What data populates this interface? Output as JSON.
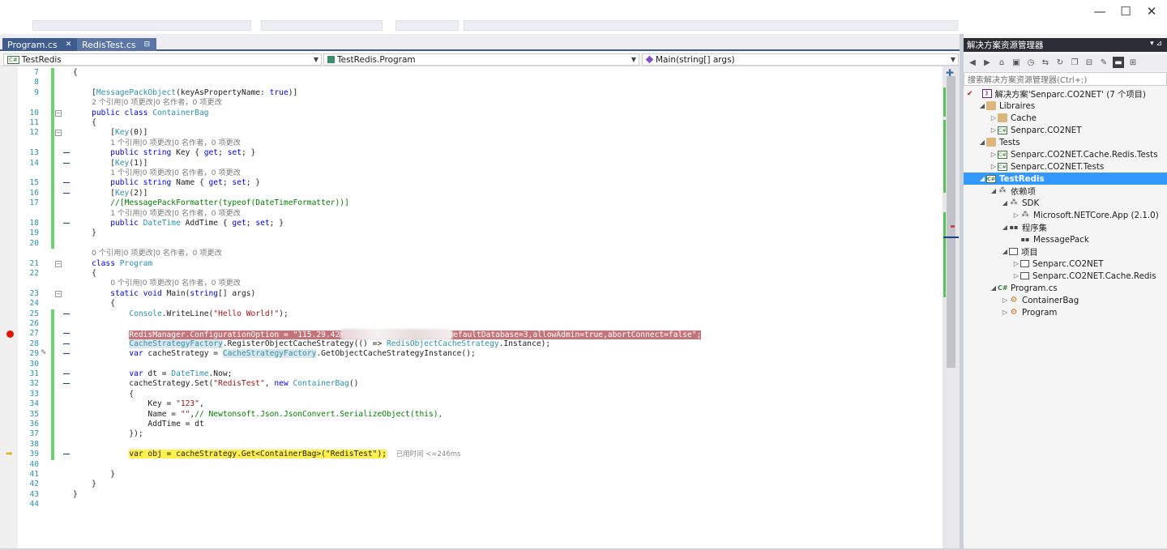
{
  "window": {
    "minimize": "—",
    "maximize": "☐",
    "close": "✕"
  },
  "tabs": [
    {
      "label": "Program.cs",
      "pin": "✕",
      "active": true
    },
    {
      "label": "RedisTest.cs",
      "pin": "⊟",
      "active": false
    }
  ],
  "nav": {
    "project": "TestRedis",
    "type": "TestRedis.Program",
    "member": "Main(string[] args)"
  },
  "editor": {
    "elapsed": "已用时间 <=246ms",
    "blurred_connection_suffix": "efaultDatabase=3,allowAdmin=true,abortConnect=false\";",
    "connection_prefix": "RedisManager.ConfigurationOption = \"115.29.42"
  },
  "solution_explorer": {
    "title": "解决方案资源管理器",
    "pin": "▾ ⊿",
    "search_placeholder": "搜索解决方案资源管理器(Ctrl+;)",
    "tree": [
      {
        "label": "解决方案'Senparc.CO2NET' (7 个项目)",
        "level": 0,
        "icon": "sln",
        "exp": ""
      },
      {
        "label": "Libraires",
        "level": 1,
        "icon": "folder",
        "exp": "◢"
      },
      {
        "label": "Cache",
        "level": 2,
        "icon": "folder",
        "exp": "▷"
      },
      {
        "label": "Senparc.CO2NET",
        "level": 2,
        "icon": "csproj",
        "exp": "▷"
      },
      {
        "label": "Tests",
        "level": 1,
        "icon": "folder",
        "exp": "◢"
      },
      {
        "label": "Senparc.CO2NET.Cache.Redis.Tests",
        "level": 2,
        "icon": "csproj",
        "exp": "▷"
      },
      {
        "label": "Senparc.CO2NET.Tests",
        "level": 2,
        "icon": "csproj",
        "exp": "▷"
      },
      {
        "label": "TestRedis",
        "level": 1,
        "icon": "csproj",
        "exp": "◢",
        "selected": true
      },
      {
        "label": "依赖项",
        "level": 2,
        "icon": "dep",
        "exp": "◢"
      },
      {
        "label": "SDK",
        "level": 3,
        "icon": "dep",
        "exp": "◢"
      },
      {
        "label": "Microsoft.NETCore.App (2.1.0)",
        "level": 4,
        "icon": "dep",
        "exp": "▷"
      },
      {
        "label": "程序集",
        "level": 3,
        "icon": "asm",
        "exp": "◢"
      },
      {
        "label": "MessagePack",
        "level": 4,
        "icon": "asm",
        "exp": ""
      },
      {
        "label": "项目",
        "level": 3,
        "icon": "box",
        "exp": "◢"
      },
      {
        "label": "Senparc.CO2NET",
        "level": 4,
        "icon": "box",
        "exp": "▷"
      },
      {
        "label": "Senparc.CO2NET.Cache.Redis",
        "level": 4,
        "icon": "box",
        "exp": "▷"
      },
      {
        "label": "Program.cs",
        "level": 2,
        "icon": "cs",
        "exp": "◢"
      },
      {
        "label": "ContainerBag",
        "level": 3,
        "icon": "class",
        "exp": "▷"
      },
      {
        "label": "Program",
        "level": 3,
        "icon": "class",
        "exp": "▷"
      }
    ]
  },
  "code_lines": [
    {
      "n": "7",
      "chg": true,
      "html": "{"
    },
    {
      "n": "8",
      "chg": true,
      "html": ""
    },
    {
      "n": "9",
      "chg": true,
      "html": "    [<span class='ty'>MessagePackObject</span>(keyAsPropertyName: <span class='kw'>true</span>)]"
    },
    {
      "n": "",
      "chg": true,
      "html": "    <span class='lens'>2 个引用|0 项更改|0 名作者，0 项更改</span>"
    },
    {
      "n": "10",
      "chg": true,
      "out": "−",
      "html": "    <span class='kw'>public class</span> <span class='ty'>ContainerBag</span>"
    },
    {
      "n": "11",
      "chg": true,
      "html": "    {"
    },
    {
      "n": "12",
      "chg": true,
      "out": "−",
      "html": "        [<span class='ty'>Key</span>(0)]"
    },
    {
      "n": "",
      "chg": true,
      "html": "        <span class='lens'>1 个引用|0 项更改|0 名作者，0 项更改</span>"
    },
    {
      "n": "13",
      "chg": true,
      "mark": true,
      "html": "        <span class='kw'>public string</span> Key { <span class='kw'>get</span>; <span class='kw'>set</span>; }"
    },
    {
      "n": "14",
      "chg": true,
      "mark": true,
      "html": "        [<span class='ty'>Key</span>(1)]"
    },
    {
      "n": "",
      "chg": true,
      "html": "        <span class='lens'>1 个引用|0 项更改|0 名作者，0 项更改</span>"
    },
    {
      "n": "15",
      "chg": true,
      "mark": true,
      "html": "        <span class='kw'>public string</span> Name { <span class='kw'>get</span>; <span class='kw'>set</span>; }"
    },
    {
      "n": "16",
      "chg": true,
      "mark": true,
      "html": "        [<span class='ty'>Key</span>(2)]"
    },
    {
      "n": "17",
      "chg": true,
      "html": "        <span class='cm'>//[MessagePackFormatter(typeof(DateTimeFormatter))]</span>"
    },
    {
      "n": "",
      "chg": true,
      "html": "        <span class='lens'>1 个引用|0 项更改|0 名作者，0 项更改</span>"
    },
    {
      "n": "18",
      "chg": true,
      "mark": true,
      "html": "        <span class='kw'>public</span> <span class='ty'>DateTime</span> AddTime { <span class='kw'>get</span>; <span class='kw'>set</span>; }"
    },
    {
      "n": "19",
      "chg": true,
      "html": "    }"
    },
    {
      "n": "20",
      "chg": true,
      "html": ""
    },
    {
      "n": "",
      "chg": false,
      "html": "    <span class='lens'>0 个引用|0 项更改|0 名作者，0 项更改</span>"
    },
    {
      "n": "21",
      "chg": false,
      "out": "−",
      "html": "    <span class='kw'>class</span> <span class='ty'>Program</span>"
    },
    {
      "n": "22",
      "chg": false,
      "html": "    {"
    },
    {
      "n": "",
      "chg": false,
      "html": "        <span class='lens'>0 个引用|0 项更改|0 名作者，0 项更改</span>"
    },
    {
      "n": "23",
      "chg": false,
      "out": "−",
      "html": "        <span class='kw'>static void</span> Main(<span class='kw'>string</span>[] args)"
    },
    {
      "n": "24",
      "chg": false,
      "html": "        {"
    },
    {
      "n": "25",
      "chg": true,
      "mark": true,
      "html": "            <span class='ty'>Console</span>.WriteLine(<span class='str'>\"Hello World!\"</span>);"
    },
    {
      "n": "26",
      "chg": true,
      "html": ""
    },
    {
      "n": "27",
      "chg": true,
      "mark": true,
      "bp": true,
      "html": "            <span class='hl-bp'>RedisManager.ConfigurationOption = \"115.29.42<span class='blur'></span>efaultDatabase=3,allowAdmin=true,abortConnect=false\";</span>"
    },
    {
      "n": "28",
      "chg": true,
      "mark": true,
      "html": "            <span class='hl-ref'><span class='ty'>CacheStrategyFactory</span></span>.RegisterObjectCacheStrategy(() =&gt; <span class='ty'>RedisObjectCacheStrategy</span>.Instance);"
    },
    {
      "n": "29",
      "chg": true,
      "mark": true,
      "pencil": true,
      "html": "            <span class='kw'>var</span> cacheStrategy = <span class='hl-ref'><span class='ty'>CacheStrategyFactory</span></span>.GetObjectCacheStrategyInstance();"
    },
    {
      "n": "30",
      "chg": true,
      "html": ""
    },
    {
      "n": "31",
      "chg": true,
      "mark": true,
      "html": "            <span class='kw'>var</span> dt = <span class='ty'>DateTime</span>.Now;"
    },
    {
      "n": "32",
      "chg": true,
      "mark": true,
      "html": "            cacheStrategy.Set(<span class='str'>\"RedisTest\"</span>, <span class='kw'>new</span> <span class='ty'>ContainerBag</span>()"
    },
    {
      "n": "33",
      "chg": true,
      "html": "            {"
    },
    {
      "n": "34",
      "chg": true,
      "html": "                Key = <span class='str'>\"123\"</span>,"
    },
    {
      "n": "35",
      "chg": true,
      "html": "                Name = <span class='str'>\"\"</span>,<span class='cm'>// Newtonsoft.Json.JsonConvert.SerializeObject(this),</span>"
    },
    {
      "n": "36",
      "chg": true,
      "html": "                AddTime = dt"
    },
    {
      "n": "37",
      "chg": true,
      "html": "            });"
    },
    {
      "n": "38",
      "chg": true,
      "html": ""
    },
    {
      "n": "39",
      "chg": true,
      "mark": true,
      "cur": true,
      "html": "            <span class='hl-cur'><span class='kw' style='color:#1e1e1e'>var</span> obj = cacheStrategy.Get&lt;<span class='ty' style='color:#1e1e1e'>ContainerBag</span>&gt;(<span class='str' style='color:#1e1e1e'>\"RedisTest\"</span>);</span>  <span class='elapsed'>已用时间 &lt;=246ms</span>"
    },
    {
      "n": "40",
      "chg": false,
      "html": ""
    },
    {
      "n": "41",
      "chg": false,
      "html": "        }"
    },
    {
      "n": "42",
      "chg": false,
      "html": "    }"
    },
    {
      "n": "43",
      "chg": false,
      "html": "}"
    },
    {
      "n": "44",
      "chg": false,
      "html": ""
    }
  ]
}
